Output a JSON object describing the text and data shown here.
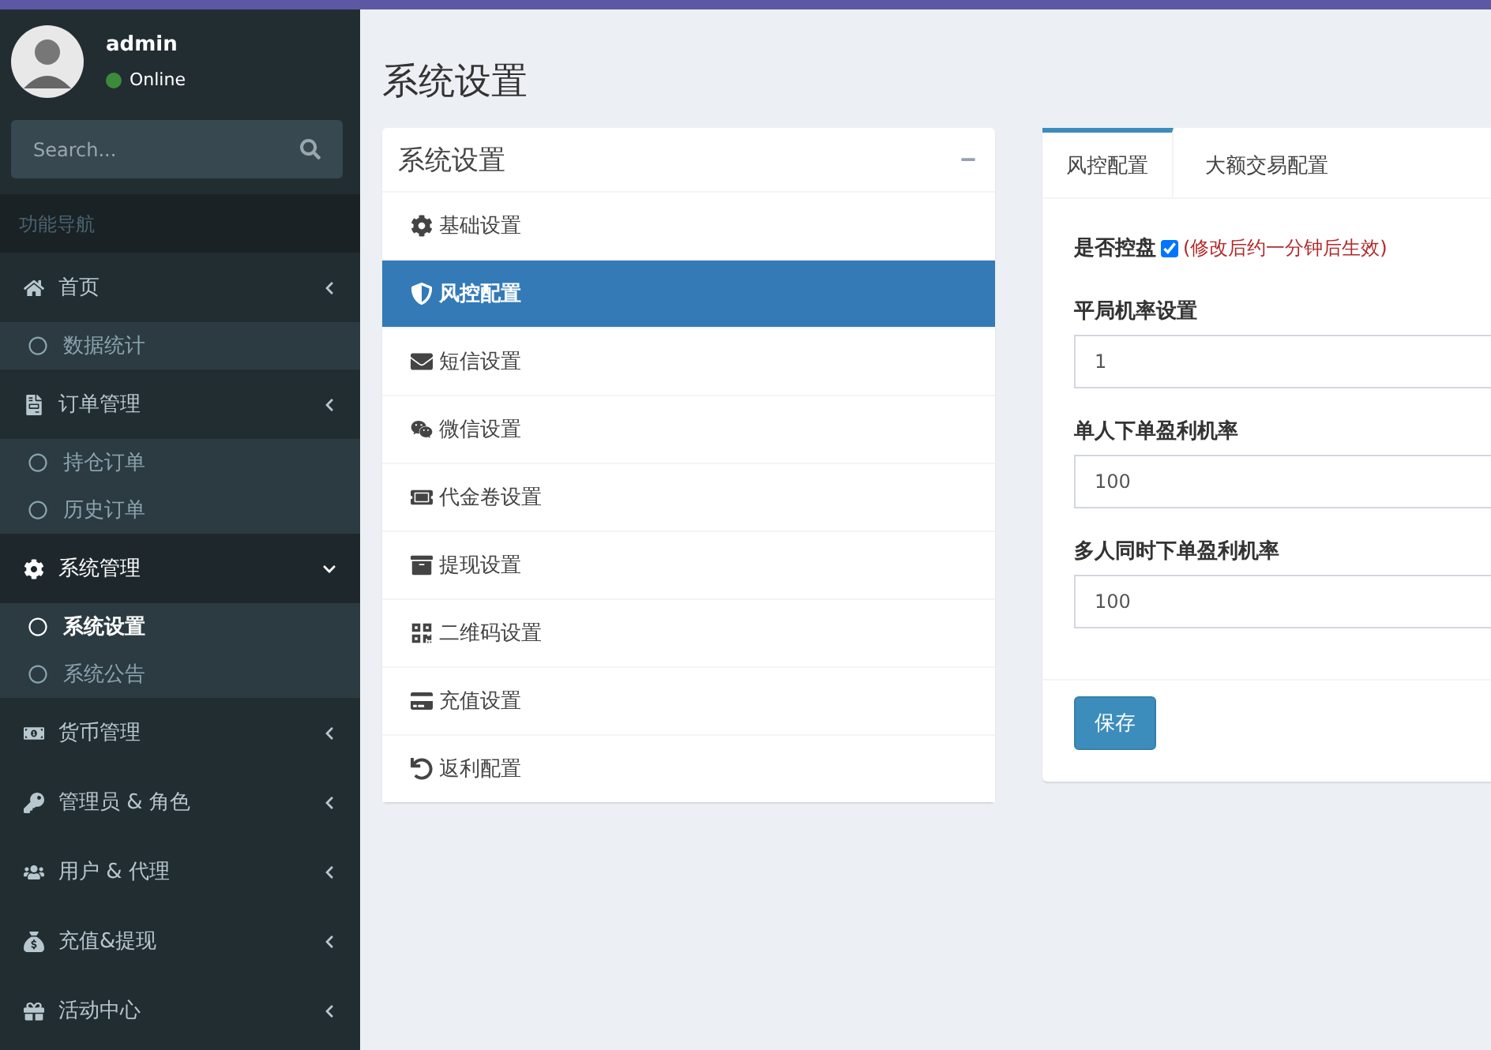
{
  "user": {
    "name": "admin",
    "status": "Online"
  },
  "search": {
    "placeholder": "Search..."
  },
  "nav_header": "功能导航",
  "menu": [
    {
      "label": "首页",
      "active": false,
      "children": [
        {
          "label": "数据统计",
          "selected": false
        }
      ]
    },
    {
      "label": "订单管理",
      "active": false,
      "children": [
        {
          "label": "持仓订单",
          "selected": false
        },
        {
          "label": "历史订单",
          "selected": false
        }
      ]
    },
    {
      "label": "系统管理",
      "active": true,
      "children": [
        {
          "label": "系统设置",
          "selected": true
        },
        {
          "label": "系统公告",
          "selected": false
        }
      ]
    },
    {
      "label": "货币管理",
      "active": false
    },
    {
      "label": "管理员 & 角色",
      "active": false
    },
    {
      "label": "用户 & 代理",
      "active": false
    },
    {
      "label": "充值&提现",
      "active": false
    },
    {
      "label": "活动中心",
      "active": false
    }
  ],
  "page_title": "系统设置",
  "settings_box": {
    "title": "系统设置",
    "items": [
      {
        "label": "基础设置",
        "selected": false
      },
      {
        "label": "风控配置",
        "selected": true
      },
      {
        "label": "短信设置",
        "selected": false
      },
      {
        "label": "微信设置",
        "selected": false
      },
      {
        "label": "代金卷设置",
        "selected": false
      },
      {
        "label": "提现设置",
        "selected": false
      },
      {
        "label": "二维码设置",
        "selected": false
      },
      {
        "label": "充值设置",
        "selected": false
      },
      {
        "label": "返利配置",
        "selected": false
      }
    ]
  },
  "tabs": [
    {
      "label": "风控配置",
      "selected": true
    },
    {
      "label": "大额交易配置",
      "selected": false
    }
  ],
  "form": {
    "control": {
      "label": "是否控盘",
      "checked": true,
      "note": "(修改后约一分钟后生效)"
    },
    "fields": [
      {
        "label": "平局机率设置",
        "value": "1"
      },
      {
        "label": "单人下单盈利机率",
        "value": "100"
      },
      {
        "label": "多人同时下单盈利机率",
        "value": "100"
      }
    ],
    "submit": "保存"
  }
}
